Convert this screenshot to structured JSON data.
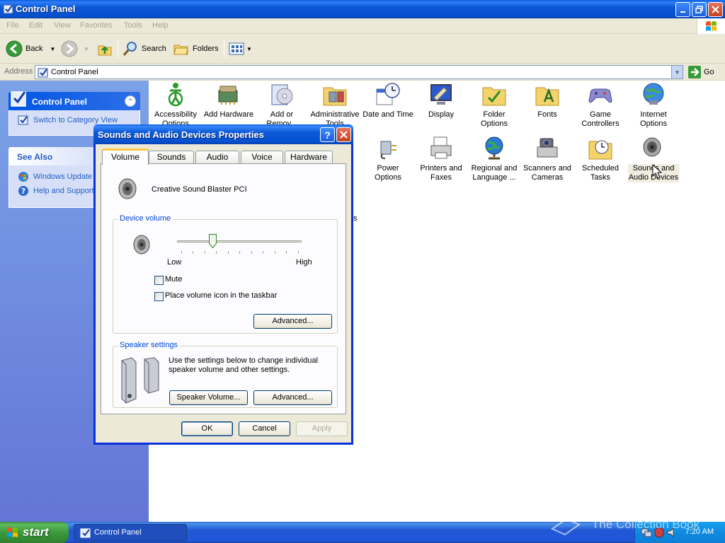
{
  "window": {
    "title": "Control Panel",
    "menu": [
      "File",
      "Edit",
      "View",
      "Favorites",
      "Tools",
      "Help"
    ],
    "toolbar": {
      "back": "Back",
      "search": "Search",
      "folders": "Folders"
    },
    "address": {
      "label": "Address",
      "value": "Control Panel",
      "go": "Go"
    }
  },
  "taskpane": {
    "control_panel": {
      "title": "Control Panel",
      "switch_link": "Switch to Category View"
    },
    "see_also": {
      "title": "See Also",
      "links": [
        "Windows Update",
        "Help and Support"
      ]
    }
  },
  "items": [
    {
      "label": "Accessibility Options",
      "icon": "accessibility-icon"
    },
    {
      "label": "Add Hardware",
      "icon": "add-hardware-icon"
    },
    {
      "label": "Add or Remov...",
      "icon": "add-remove-programs-icon"
    },
    {
      "label": "Administrative Tools",
      "icon": "admin-tools-icon"
    },
    {
      "label": "Date and Time",
      "icon": "date-time-icon"
    },
    {
      "label": "Display",
      "icon": "display-icon"
    },
    {
      "label": "Folder Options",
      "icon": "folder-options-icon"
    },
    {
      "label": "Fonts",
      "icon": "fonts-icon"
    },
    {
      "label": "Game Controllers",
      "icon": "game-controllers-icon"
    },
    {
      "label": "Internet Options",
      "icon": "internet-options-icon"
    },
    {
      "label": "Power Options",
      "icon": "power-options-icon"
    },
    {
      "label": "Printers and Faxes",
      "icon": "printers-faxes-icon"
    },
    {
      "label": "Regional and Language ...",
      "icon": "regional-language-icon"
    },
    {
      "label": "Scanners and Cameras",
      "icon": "scanners-cameras-icon"
    },
    {
      "label": "Scheduled Tasks",
      "icon": "scheduled-tasks-icon"
    },
    {
      "label": "Sounds and Audio Devices",
      "icon": "sounds-audio-icon"
    }
  ],
  "partial_text": "ts",
  "dialog": {
    "title": "Sounds and Audio Devices Properties",
    "tabs": [
      "Volume",
      "Sounds",
      "Audio",
      "Voice",
      "Hardware"
    ],
    "active_tab": "Volume",
    "device_name": "Creative Sound Blaster PCI",
    "device_volume": {
      "label": "Device volume",
      "low": "Low",
      "high": "High",
      "level": 0.27
    },
    "mute_label": "Mute",
    "mute_checked": false,
    "taskbar_icon_label": "Place volume icon in the taskbar",
    "taskbar_icon_checked": false,
    "advanced_label": "Advanced...",
    "speaker_settings": {
      "label": "Speaker settings",
      "description": "Use the settings below to change individual speaker volume and other settings.",
      "speaker_volume_button": "Speaker Volume...",
      "advanced_button": "Advanced..."
    },
    "buttons": {
      "ok": "OK",
      "cancel": "Cancel",
      "apply": "Apply"
    }
  },
  "taskbar": {
    "start": "start",
    "task": "Control Panel",
    "clock": "7:20 AM"
  },
  "watermark": "The Collection Book",
  "colors": {
    "xp_blue": "#0a5fe0",
    "taskpane_link": "#215dc6",
    "group_label": "#0046d5",
    "tab_highlight": "#ffc83c"
  }
}
